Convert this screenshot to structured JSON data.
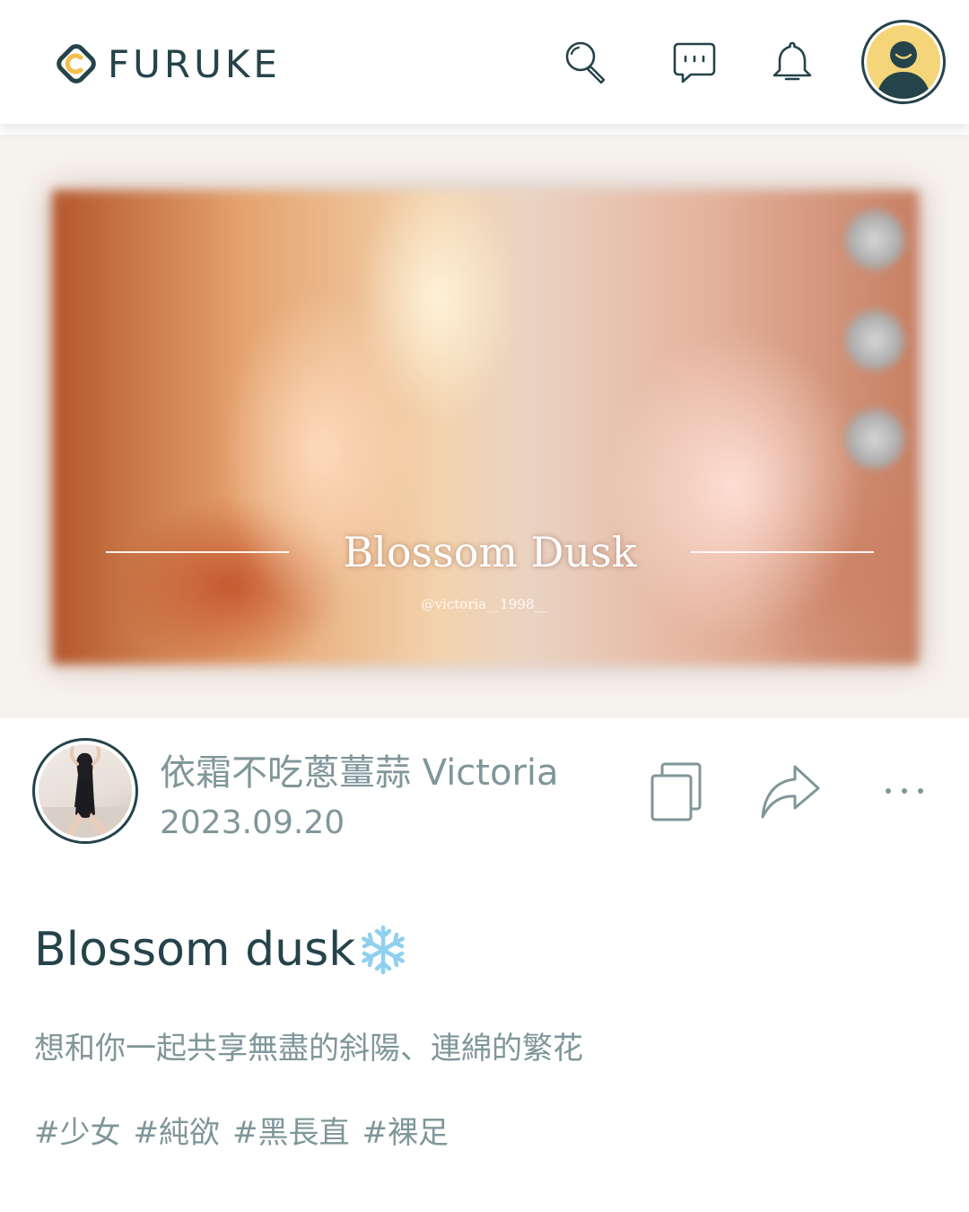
{
  "header": {
    "logo_text": "FURUKE",
    "icons": [
      "search-icon",
      "message-icon",
      "bell-icon",
      "user-avatar-icon"
    ]
  },
  "banner": {
    "title": "Blossom Dusk",
    "handle": "@victoria__1998__"
  },
  "author": {
    "name": "依霜不吃蔥薑蒜 Victoria",
    "date": "2023.09.20"
  },
  "actions": [
    "copy-icon",
    "share-icon",
    "more-icon"
  ],
  "post": {
    "title": "Blossom dusk",
    "emoji": "snowflake",
    "description": "想和你一起共享無盡的斜陽、連綿的繁花",
    "tags": [
      "#少女",
      "#純欲",
      "#黑長直",
      "#裸足"
    ]
  },
  "colors": {
    "brand_dark": "#25434a",
    "muted_text": "#7f969a",
    "avatar_bg": "#f4d57a",
    "logo_accent": "#f2c04a"
  }
}
